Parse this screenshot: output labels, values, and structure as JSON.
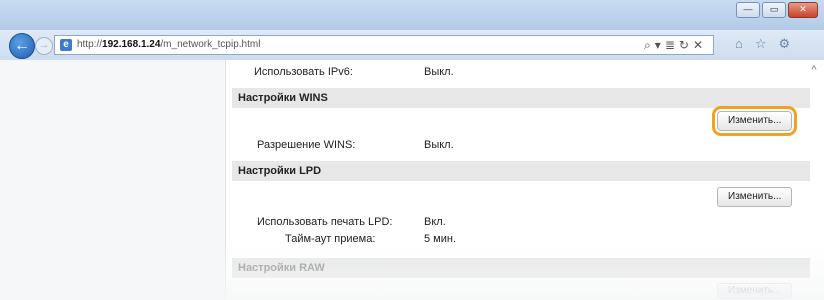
{
  "browser": {
    "url_prefix": "http://",
    "url_host": "192.168.1.24",
    "url_path": "/m_network_tcpip.html",
    "address_tools": [
      "⌕",
      "▾",
      "≣",
      "↻",
      "✕"
    ],
    "right_tools": [
      "⌂",
      "☆",
      "⚙"
    ],
    "window_controls": [
      "—",
      "▭",
      "✕"
    ]
  },
  "content": {
    "ipv6_label": "Использовать IPv6:",
    "ipv6_value": "Выкл.",
    "wins_header": "Настройки WINS",
    "wins_button": "Изменить...",
    "wins_label": "Разрешение WINS:",
    "wins_value": "Выкл.",
    "lpd_header": "Настройки LPD",
    "lpd_button": "Изменить...",
    "lpd_print_label": "Использовать печать LPD:",
    "lpd_print_value": "Вкл.",
    "lpd_timeout_label": "Тайм-аут приема:",
    "lpd_timeout_value": "5 мин.",
    "raw_header": "Настройки RAW",
    "raw_button": "Изменить..."
  }
}
